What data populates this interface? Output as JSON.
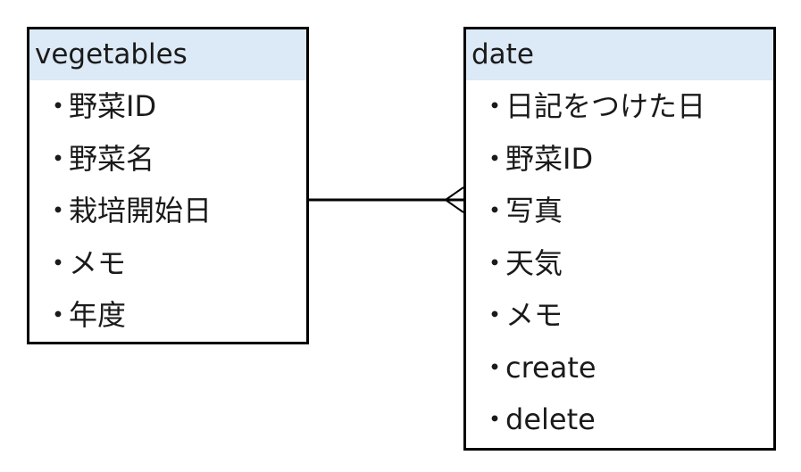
{
  "entities": {
    "vegetables": {
      "name": "vegetables",
      "fields": [
        "野菜ID",
        "野菜名",
        "栽培開始日",
        "メモ",
        "年度"
      ]
    },
    "date": {
      "name": "date",
      "fields": [
        "日記をつけた日",
        "野菜ID",
        "写真",
        "天気",
        "メモ",
        "create",
        "delete"
      ]
    }
  },
  "bullet": "・",
  "relationship": {
    "from": "vegetables",
    "to": "date",
    "from_cardinality": "one",
    "to_cardinality": "many",
    "notation": "crow's foot"
  },
  "colors": {
    "header_fill": "#dce9f6",
    "border": "#000000",
    "text": "#1a1a1a"
  }
}
